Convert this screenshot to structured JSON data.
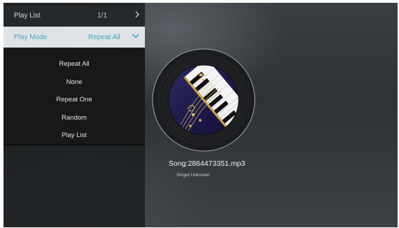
{
  "playlist_row": {
    "label": "Play List",
    "value": "1/1"
  },
  "playmode_row": {
    "label": "Play Mode",
    "value": "Repeat All"
  },
  "mode_options": [
    "Repeat All",
    "None",
    "Repeat One",
    "Random",
    "Play List"
  ],
  "song": {
    "title": "Song:2864473351.mp3",
    "singer": "Singer:Unknown"
  },
  "colors": {
    "accent": "#4aa3c8",
    "selected_row_bg": "#dfe3e5",
    "panel_bg": "#1b1d1f"
  },
  "icons": {
    "playlist_arrow": "chevron-right-icon",
    "playmode_arrow": "chevron-down-icon",
    "artwork": "music-disc-icon"
  }
}
